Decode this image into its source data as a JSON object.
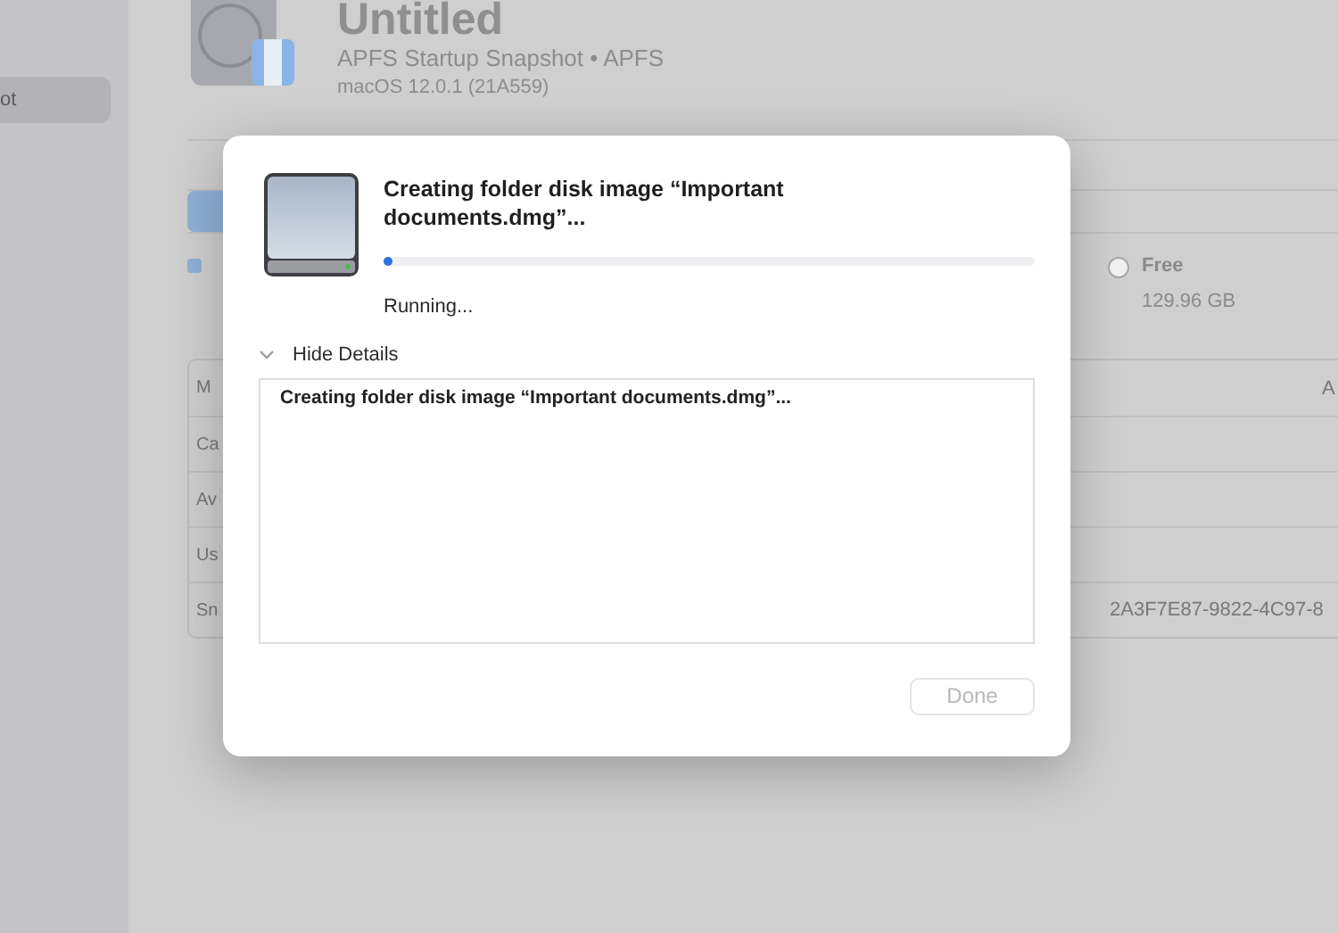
{
  "sidebar": {
    "items": [
      {
        "label": "ot",
        "selected": true
      }
    ]
  },
  "volume": {
    "title": "Untitled",
    "subtitle": "APFS Startup Snapshot • APFS",
    "version": "macOS 12.0.1 (21A559)"
  },
  "usage": {
    "legend": [
      {
        "label": "Free",
        "value": "129.96 GB",
        "color": "#f2f2f2"
      }
    ]
  },
  "table": {
    "rows": [
      {
        "column_1": "M",
        "column_3": "A"
      },
      {
        "column_1": "Ca"
      },
      {
        "column_1": "Av"
      },
      {
        "column_1": "Us"
      },
      {
        "column_1": "Sn",
        "column_2": "2A3F7E87-9822-4C97-8"
      }
    ]
  },
  "dialog": {
    "title": "Creating folder disk image “Important documents.dmg”...",
    "progress": {
      "level": 0.012
    },
    "status": "Running...",
    "details": {
      "label": "Hide Details",
      "expanded": true,
      "log": "Creating folder disk image “Important documents.dmg”..."
    },
    "buttons": [
      {
        "label": "Done",
        "disabled": true
      }
    ]
  }
}
